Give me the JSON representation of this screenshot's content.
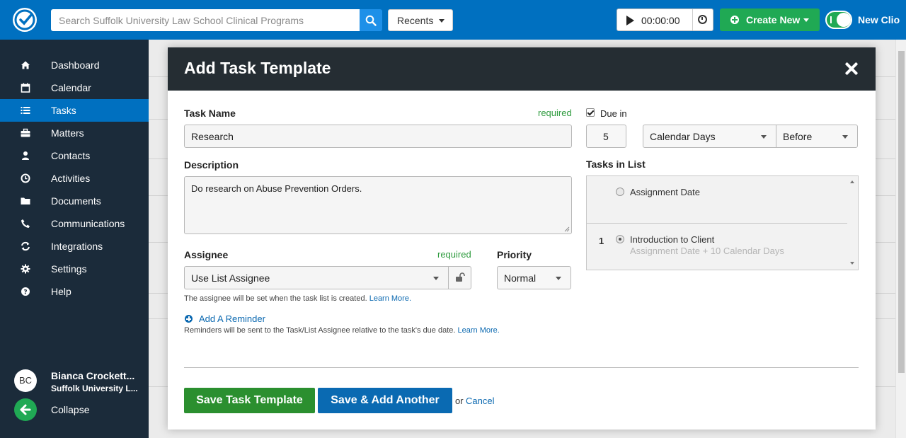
{
  "topbar": {
    "search_placeholder": "Search Suffolk University Law School Clinical Programs",
    "recents_label": "Recents",
    "timer_value": "00:00:00",
    "create_new_label": "Create New",
    "new_clio_label": "New Clio"
  },
  "sidebar": {
    "items": [
      {
        "label": "Dashboard",
        "icon": "home-icon"
      },
      {
        "label": "Calendar",
        "icon": "calendar-icon"
      },
      {
        "label": "Tasks",
        "icon": "list-icon",
        "active": true
      },
      {
        "label": "Matters",
        "icon": "briefcase-icon"
      },
      {
        "label": "Contacts",
        "icon": "person-icon"
      },
      {
        "label": "Activities",
        "icon": "clock-icon"
      },
      {
        "label": "Documents",
        "icon": "folder-icon"
      },
      {
        "label": "Communications",
        "icon": "phone-icon"
      },
      {
        "label": "Integrations",
        "icon": "sync-icon"
      },
      {
        "label": "Settings",
        "icon": "gear-icon"
      },
      {
        "label": "Help",
        "icon": "help-icon"
      }
    ],
    "user": {
      "initials": "BC",
      "name": "Bianca Crockett...",
      "org": "Suffolk University L..."
    },
    "collapse_label": "Collapse"
  },
  "modal": {
    "title": "Add Task Template",
    "task_name_label": "Task Name",
    "task_name_required": "required",
    "task_name_value": "Research",
    "description_label": "Description",
    "description_value": "Do research on Abuse Prevention Orders.",
    "assignee_label": "Assignee",
    "assignee_required": "required",
    "assignee_value": "Use List Assignee",
    "assignee_help": "The assignee will be set when the task list is created.",
    "learn_more": "Learn More.",
    "priority_label": "Priority",
    "priority_value": "Normal",
    "add_reminder_label": "Add A Reminder",
    "reminder_help": "Reminders will be sent to the Task/List Assignee relative to the task's due date.",
    "due_in_label": "Due in",
    "due_in_checked": true,
    "due_in_value": "5",
    "due_unit_value": "Calendar Days",
    "due_relation_value": "Before",
    "tasks_in_list_label": "Tasks in List",
    "tasks_in_list": [
      {
        "number": "",
        "name": "Assignment Date",
        "detail": "",
        "selected": false
      },
      {
        "number": "1",
        "name": "Introduction to Client",
        "detail": "Assignment Date + 10 Calendar Days",
        "selected": true
      }
    ],
    "save_label": "Save Task Template",
    "save_add_label": "Save & Add Another",
    "or_label": "or",
    "cancel_label": "Cancel"
  },
  "colors": {
    "topbar": "#0070c0",
    "sidebar": "#1b2b3a",
    "accent_green": "#20a954",
    "modal_header": "#252d33",
    "save_button": "#2b8f2f",
    "save_add_button": "#0a6ab2"
  }
}
